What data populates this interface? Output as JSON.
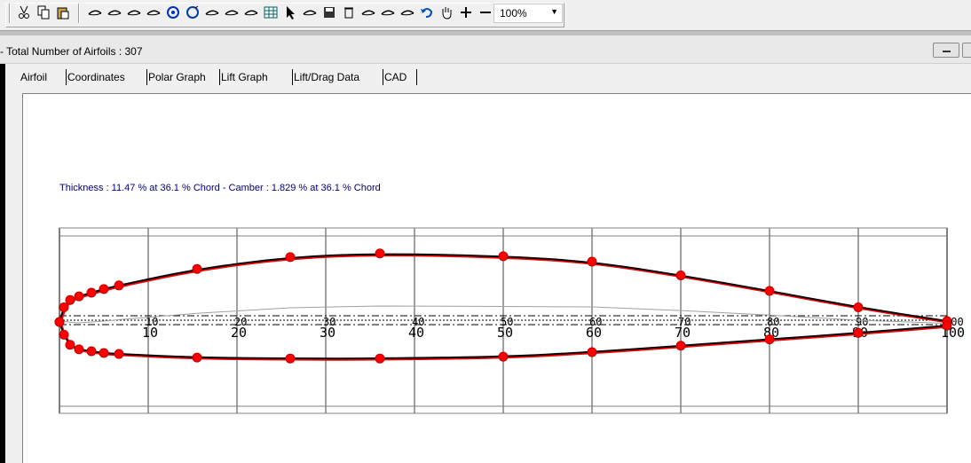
{
  "toolbar": {
    "buttons": [
      {
        "name": "cut-icon"
      },
      {
        "name": "copy-icon"
      },
      {
        "name": "paste-icon"
      },
      {
        "name": "airfoil-edit-icon"
      },
      {
        "name": "airfoil-outline-icon"
      },
      {
        "name": "flap-icon"
      },
      {
        "name": "zoom-icon"
      },
      {
        "name": "circle-target-icon"
      },
      {
        "name": "ring-icon"
      },
      {
        "name": "thickness-icon"
      },
      {
        "name": "camber-icon"
      },
      {
        "name": "airfoil-shape-icon"
      },
      {
        "name": "table-icon"
      },
      {
        "name": "pointer-icon"
      },
      {
        "name": "point-select-icon"
      },
      {
        "name": "save-icon"
      },
      {
        "name": "delete-icon"
      },
      {
        "name": "transform-icon"
      },
      {
        "name": "wing-icon"
      },
      {
        "name": "paint-icon"
      },
      {
        "name": "undo-icon"
      },
      {
        "name": "hand-pan-icon"
      },
      {
        "name": "zoom-in-icon"
      },
      {
        "name": "zoom-out-icon"
      }
    ],
    "zoom": "100%"
  },
  "window": {
    "title": "- Total Number of Airfoils : 307"
  },
  "tabs": [
    "Airfoil",
    "Coordinates",
    "Polar Graph",
    "Lift Graph",
    "Lift/Drag Data",
    "CAD"
  ],
  "info_text": "Thickness : 11.47 % at 36.1 % Chord - Camber : 1.829 % at 36.1 % Chord",
  "plot": {
    "x_ticks_upper": [
      "10",
      "20",
      "30",
      "40",
      "50",
      "60",
      "70",
      "80",
      "90",
      "100"
    ],
    "x_ticks_lower": [
      "10",
      "20",
      "30",
      "40",
      "50",
      "60",
      "70",
      "80",
      "90",
      "100"
    ],
    "colors": {
      "outline": "#000000",
      "points": "#ff0000",
      "grid": "#808080",
      "camber": "#a0a0a0"
    }
  },
  "chart_data": {
    "type": "line",
    "series": [
      {
        "name": "",
        "x": [
          0,
          0.5,
          1.2,
          2.2,
          3.6,
          5,
          6.7,
          15.5,
          26,
          36.1,
          50,
          60,
          70,
          80,
          90,
          100
        ],
        "y": [
          0,
          1.6,
          2.4,
          2.8,
          3.2,
          3.6,
          4,
          5.8,
          7.1,
          7.5,
          7.2,
          6.6,
          5.1,
          3.4,
          1.6,
          0.1
        ]
      },
      {
        "name": "",
        "x": [
          0,
          0.5,
          1.2,
          2.2,
          3.6,
          5,
          6.7,
          15.5,
          26,
          36.1,
          50,
          60,
          70,
          80,
          90,
          100
        ],
        "y": [
          0,
          -1.4,
          -2.5,
          -3,
          -3.2,
          -3.4,
          -3.5,
          -3.9,
          -4,
          -4,
          -3.8,
          -3.3,
          -2.6,
          -1.9,
          -1.2,
          -0.4
        ]
      }
    ],
    "xlim": [
      0,
      100
    ],
    "ylim": [
      -10,
      10
    ],
    "grid": true
  }
}
